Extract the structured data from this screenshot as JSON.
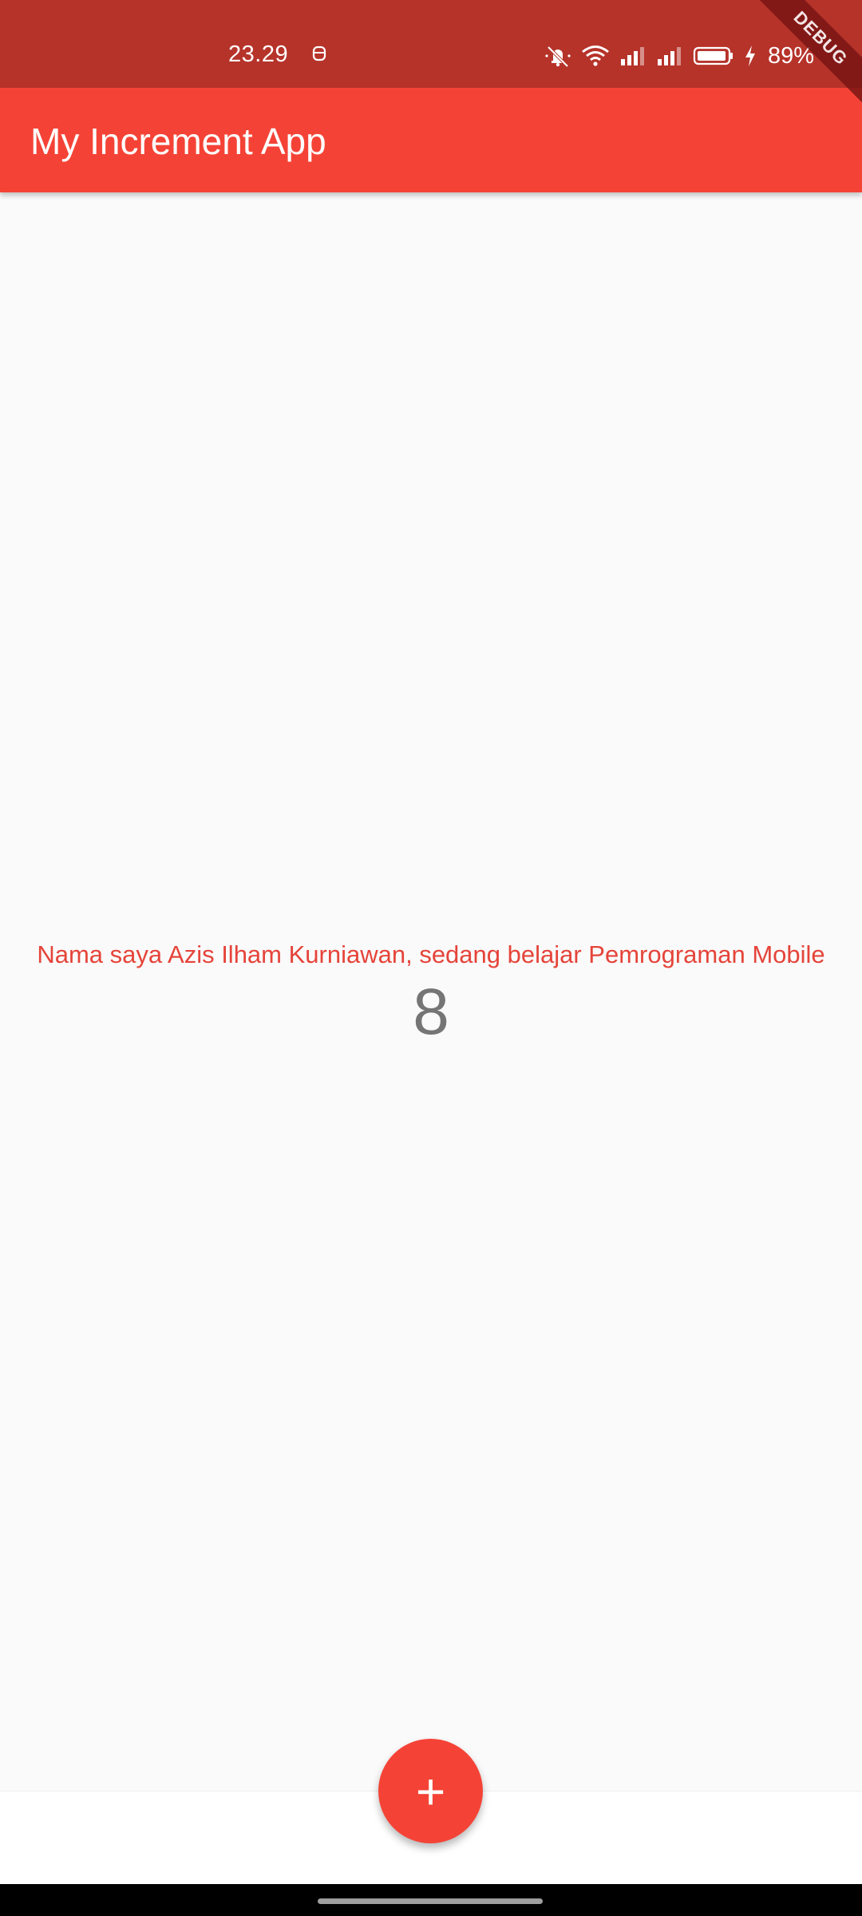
{
  "status_bar": {
    "time": "23.29",
    "battery_percent": "89%",
    "icons": [
      "notification-app-icon",
      "mute-icon",
      "wifi-icon",
      "signal-icon",
      "signal-icon",
      "battery-icon",
      "charging-icon"
    ]
  },
  "debug_banner": {
    "label": "DEBUG"
  },
  "app_bar": {
    "title": "My Increment App"
  },
  "main": {
    "message": "Nama saya Azis Ilham Kurniawan, sedang belajar Pemrograman Mobile",
    "counter": "8"
  },
  "fab": {
    "icon": "add-icon",
    "symbol": "+"
  },
  "colors": {
    "status_bar": "#b6332a",
    "app_bar": "#f44336",
    "message_text": "#e5443a",
    "counter_text": "#757575",
    "fab": "#f44336",
    "background": "#fafafa"
  }
}
